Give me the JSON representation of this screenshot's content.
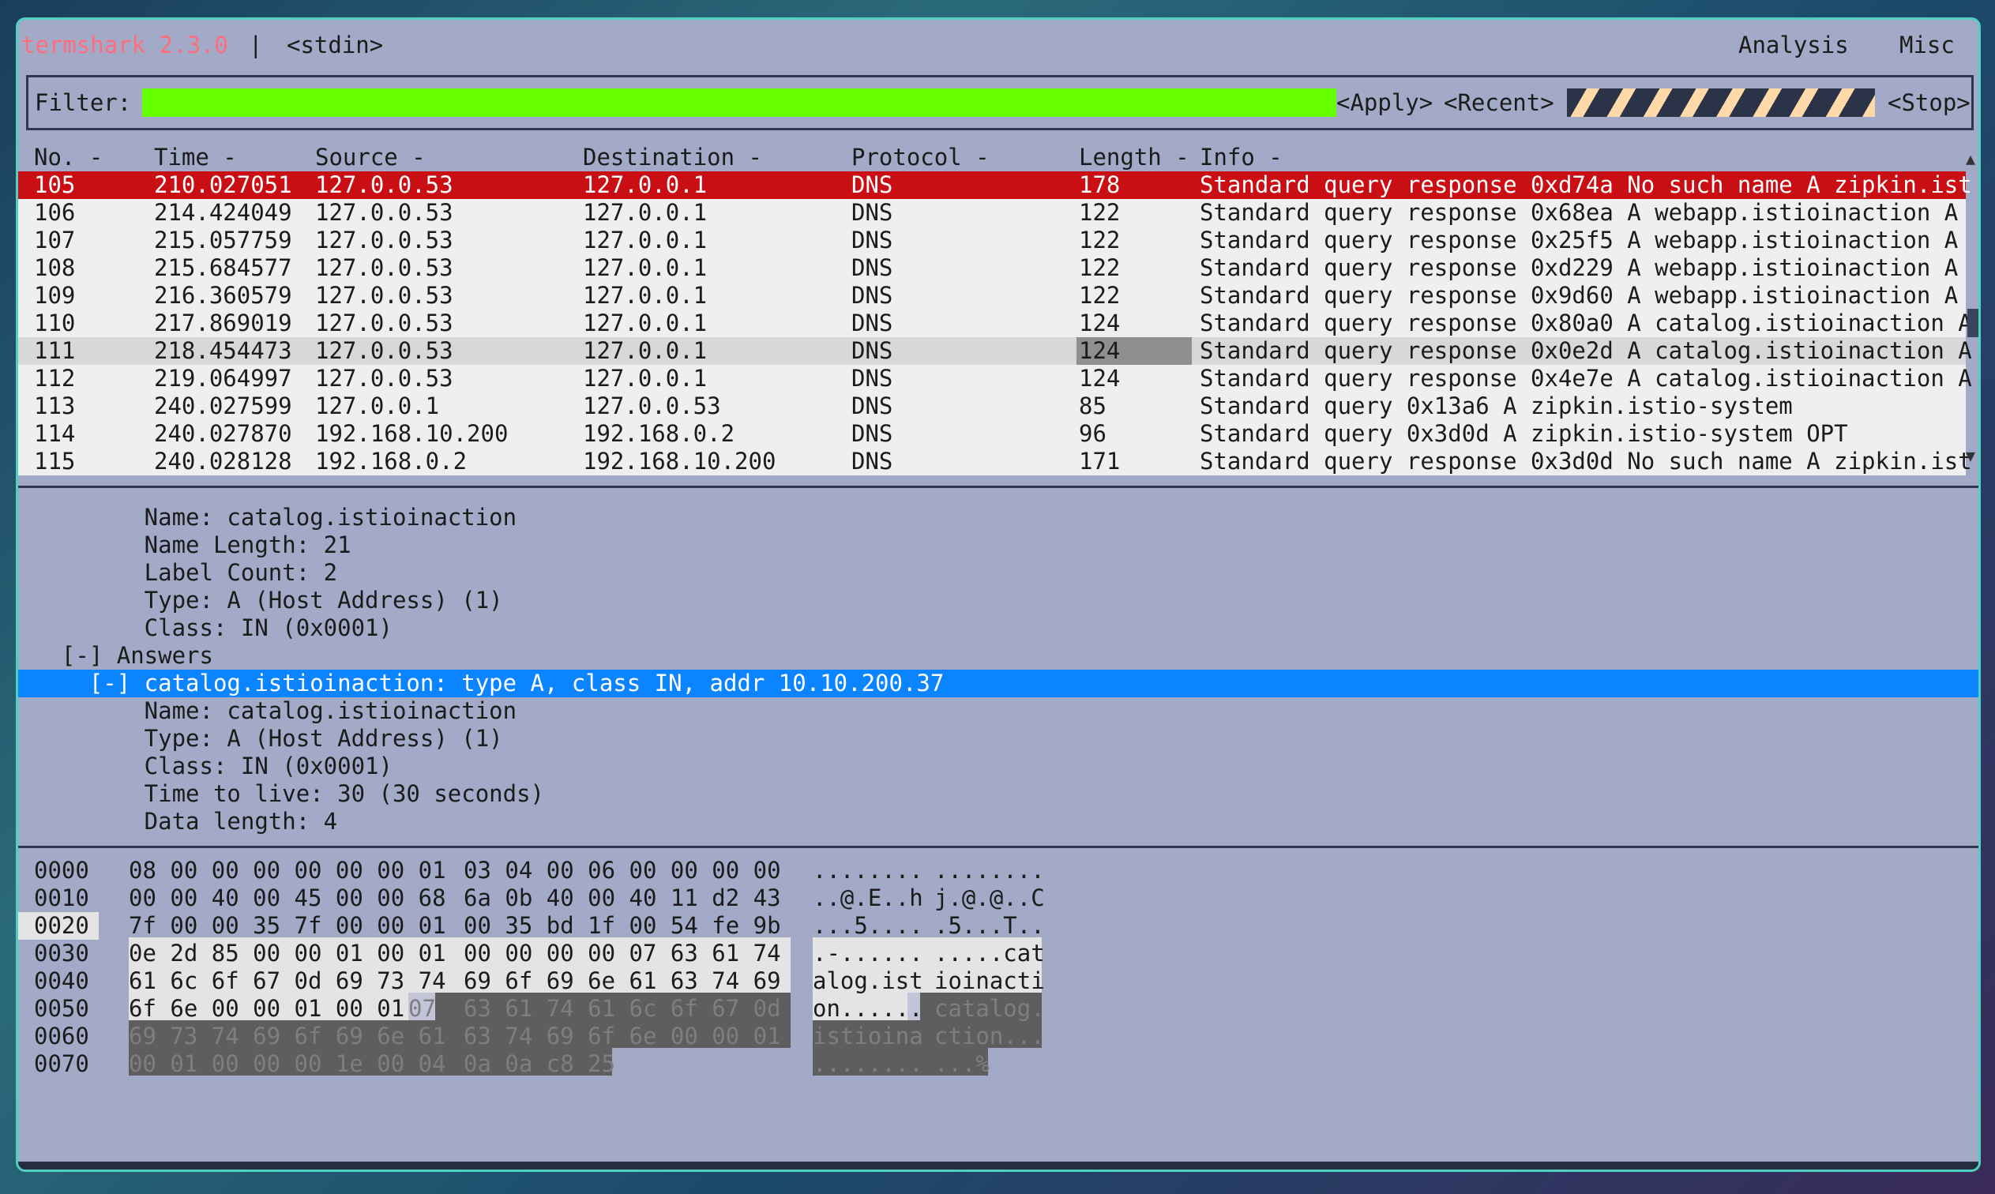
{
  "app": {
    "name": "termshark 2.3.0",
    "separator": "|",
    "source": "<stdin>"
  },
  "menu": {
    "analysis": "Analysis",
    "misc": "Misc"
  },
  "filter": {
    "label": "Filter:",
    "value": "",
    "apply": "<Apply>",
    "recent": "<Recent>",
    "stop": "<Stop>",
    "loading": "loading"
  },
  "columns": {
    "no": "No. -",
    "time": "Time -",
    "source": "Source -",
    "destination": "Destination -",
    "protocol": "Protocol -",
    "length": "Length -",
    "info": "Info -"
  },
  "packets": [
    {
      "no": "105",
      "time": "210.027051",
      "source": "127.0.0.53",
      "destination": "127.0.0.1",
      "protocol": "DNS",
      "length": "178",
      "info": "Standard query response 0xd74a No such name A zipkin.ist"
    },
    {
      "no": "106",
      "time": "214.424049",
      "source": "127.0.0.53",
      "destination": "127.0.0.1",
      "protocol": "DNS",
      "length": "122",
      "info": "Standard query response 0x68ea A webapp.istioinaction A"
    },
    {
      "no": "107",
      "time": "215.057759",
      "source": "127.0.0.53",
      "destination": "127.0.0.1",
      "protocol": "DNS",
      "length": "122",
      "info": "Standard query response 0x25f5 A webapp.istioinaction A"
    },
    {
      "no": "108",
      "time": "215.684577",
      "source": "127.0.0.53",
      "destination": "127.0.0.1",
      "protocol": "DNS",
      "length": "122",
      "info": "Standard query response 0xd229 A webapp.istioinaction A"
    },
    {
      "no": "109",
      "time": "216.360579",
      "source": "127.0.0.53",
      "destination": "127.0.0.1",
      "protocol": "DNS",
      "length": "122",
      "info": "Standard query response 0x9d60 A webapp.istioinaction A"
    },
    {
      "no": "110",
      "time": "217.869019",
      "source": "127.0.0.53",
      "destination": "127.0.0.1",
      "protocol": "DNS",
      "length": "124",
      "info": "Standard query response 0x80a0 A catalog.istioinaction A"
    },
    {
      "no": "111",
      "time": "218.454473",
      "source": "127.0.0.53",
      "destination": "127.0.0.1",
      "protocol": "DNS",
      "length": "124",
      "info": "Standard query response 0x0e2d A catalog.istioinaction A"
    },
    {
      "no": "112",
      "time": "219.064997",
      "source": "127.0.0.53",
      "destination": "127.0.0.1",
      "protocol": "DNS",
      "length": "124",
      "info": "Standard query response 0x4e7e A catalog.istioinaction A"
    },
    {
      "no": "113",
      "time": "240.027599",
      "source": "127.0.0.1",
      "destination": "127.0.0.53",
      "protocol": "DNS",
      "length": "85",
      "info": "Standard query 0x13a6 A zipkin.istio-system"
    },
    {
      "no": "114",
      "time": "240.027870",
      "source": "192.168.10.200",
      "destination": "192.168.0.2",
      "protocol": "DNS",
      "length": "96",
      "info": "Standard query 0x3d0d A zipkin.istio-system OPT"
    },
    {
      "no": "115",
      "time": "240.028128",
      "source": "192.168.0.2",
      "destination": "192.168.10.200",
      "protocol": "DNS",
      "length": "171",
      "info": "Standard query response 0x3d0d No such name A zipkin.ist"
    }
  ],
  "details": [
    "        Name: catalog.istioinaction",
    "        Name Length: 21",
    "        Label Count: 2",
    "        Type: A (Host Address) (1)",
    "        Class: IN (0x0001)",
    "  [-] Answers",
    "    [-] catalog.istioinaction: type A, class IN, addr 10.10.200.37",
    "        Name: catalog.istioinaction",
    "        Type: A (Host Address) (1)",
    "        Class: IN (0x0001)",
    "        Time to live: 30 (30 seconds)",
    "        Data length: 4"
  ],
  "hex": [
    {
      "offset": "0000",
      "a": "08 00 00 00 00 00 00 01",
      "b": "03 04 00 06 00 00 00 00",
      "asciiA": "........",
      "asciiB": "........"
    },
    {
      "offset": "0010",
      "a": "00 00 40 00 45 00 00 68",
      "b": "6a 0b 40 00 40 11 d2 43",
      "asciiA": "..@.E..h",
      "asciiB": "j.@.@..C"
    },
    {
      "offset": "0020",
      "a": "7f 00 00 35 7f 00 00 01",
      "b": "00 35 bd 1f 00 54 fe 9b",
      "asciiA": "...5....",
      "asciiB": ".5...T.."
    },
    {
      "offset": "0030",
      "a": "0e 2d 85 00 00 01 00 01",
      "b": "00 00 00 00 07 63 61 74",
      "asciiA": ".-......",
      "asciiB": ".....cat"
    },
    {
      "offset": "0040",
      "a": "61 6c 6f 67 0d 69 73 74",
      "b": "69 6f 69 6e 61 63 74 69",
      "asciiA": "alog.ist",
      "asciiB": "ioinacti"
    },
    {
      "offset": "0050",
      "a1": "6f 6e 00 00 01 00 01 ",
      "a2": "07",
      "b": "63 61 74 61 6c 6f 67 0d",
      "asciiA1": "on.....",
      "asciiA2": ".",
      "asciiB": "catalog."
    },
    {
      "offset": "0060",
      "a": "69 73 74 69 6f 69 6e 61",
      "b": "63 74 69 6f 6e 00 00 01",
      "asciiA": "istioina",
      "asciiB": "ction..."
    },
    {
      "offset": "0070",
      "a": "00 01 00 00 00 1e 00 04",
      "b": "0a 0a c8 25",
      "asciiA": "........",
      "asciiB": "...%"
    }
  ],
  "colors": {
    "window_bg": "#a3aac8",
    "selected_row": "#c90f14",
    "detail_highlight": "#0b84ff",
    "filter_bg": "#66ff00",
    "title": "#ff6d7c",
    "hex_highlight": "#5e5e5e"
  }
}
